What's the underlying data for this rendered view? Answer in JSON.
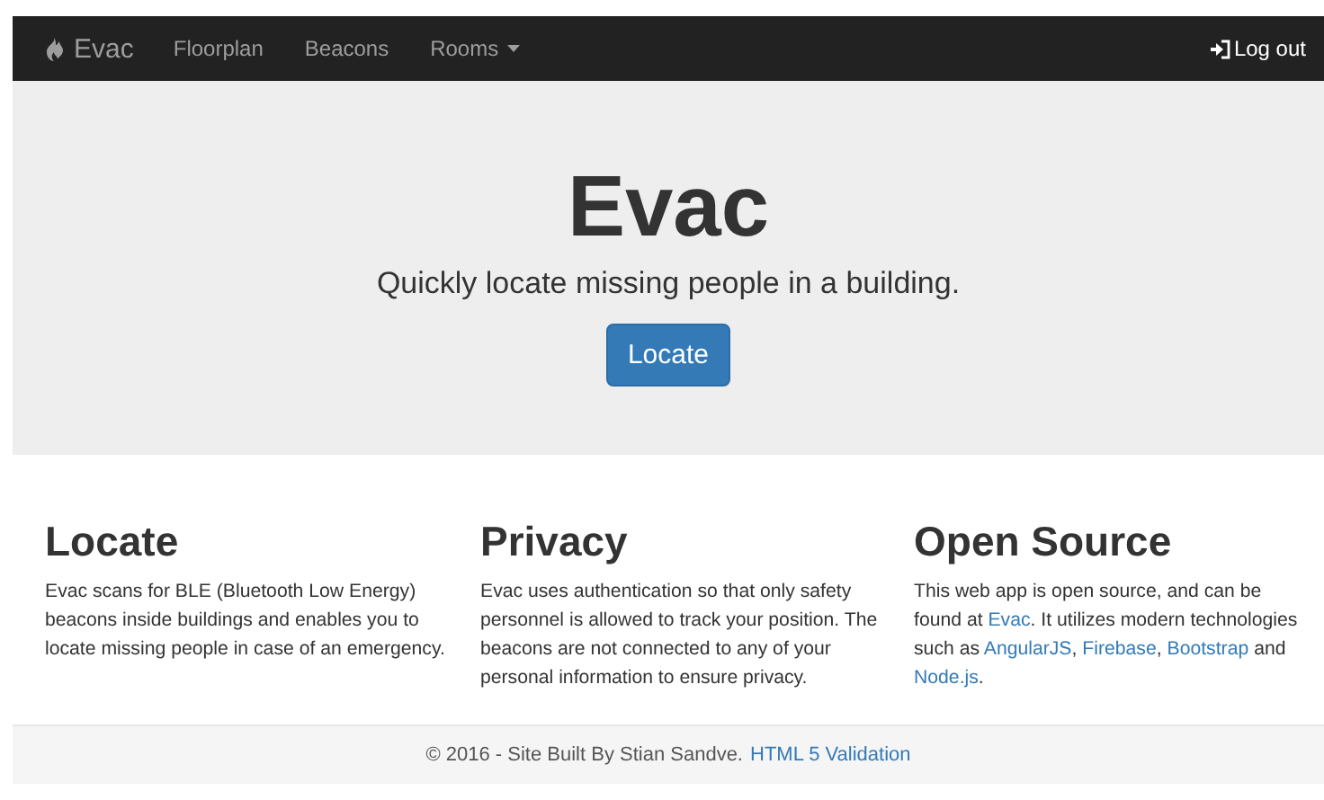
{
  "navbar": {
    "brand": "Evac",
    "items": [
      {
        "label": "Floorplan",
        "kind": "link"
      },
      {
        "label": "Beacons",
        "kind": "link"
      },
      {
        "label": "Rooms",
        "kind": "dropdown"
      }
    ],
    "logout": "Log out"
  },
  "jumbotron": {
    "title": "Evac",
    "subtitle": "Quickly locate missing people in a building.",
    "button": "Locate"
  },
  "features": [
    {
      "title": "Locate",
      "body": [
        {
          "kind": "text",
          "text": "Evac scans for BLE (Bluetooth Low Energy) beacons inside buildings and enables you to locate missing people in case of an emergency."
        }
      ]
    },
    {
      "title": "Privacy",
      "body": [
        {
          "kind": "text",
          "text": "Evac uses authentication so that only safety personnel is allowed to track your position. The beacons are not connected to any of your personal information to ensure privacy."
        }
      ]
    },
    {
      "title": "Open Source",
      "body": [
        {
          "kind": "text",
          "text": "This web app is open source, and can be found at "
        },
        {
          "kind": "link",
          "text": "Evac"
        },
        {
          "kind": "text",
          "text": ". It utilizes modern technologies such as "
        },
        {
          "kind": "link",
          "text": "AngularJS"
        },
        {
          "kind": "text",
          "text": ", "
        },
        {
          "kind": "link",
          "text": "Firebase"
        },
        {
          "kind": "text",
          "text": ", "
        },
        {
          "kind": "link",
          "text": "Bootstrap"
        },
        {
          "kind": "text",
          "text": " and "
        },
        {
          "kind": "link",
          "text": "Node.js"
        },
        {
          "kind": "text",
          "text": "."
        }
      ]
    }
  ],
  "footer": {
    "text": "© 2016 - Site Built By Stian Sandve.",
    "link": "HTML 5 Validation"
  }
}
